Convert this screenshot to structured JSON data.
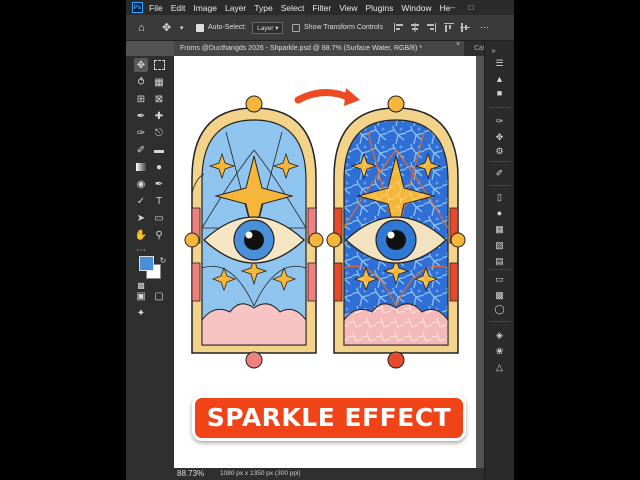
{
  "app": {
    "logo_text": "Ps",
    "menus": [
      "File",
      "Edit",
      "Image",
      "Layer",
      "Type",
      "Select",
      "Filter",
      "View",
      "Plugins",
      "Window",
      "He"
    ]
  },
  "options": {
    "auto_select_label": "Auto-Select:",
    "auto_select_value": "Layer",
    "transform_label": "Show Transform Controls"
  },
  "document": {
    "tab_title": "Froms @Ducthangds 2026 - Shparkle.psd @ 88.7% (Surface Water, RGB/8) *",
    "second_tab": "Cat S",
    "zoom": "88.73%",
    "info": "1080 px x 1350 px (300 ppi)"
  },
  "artwork": {
    "title": "SPARKLE EFFECT",
    "colors": {
      "accent": "#f04418",
      "sky": "#8fc4ee",
      "deep_blue": "#2f6fd6",
      "gold": "#f5b63a",
      "frame": "#f3d38a",
      "cloud": "#f7c3c3"
    }
  }
}
